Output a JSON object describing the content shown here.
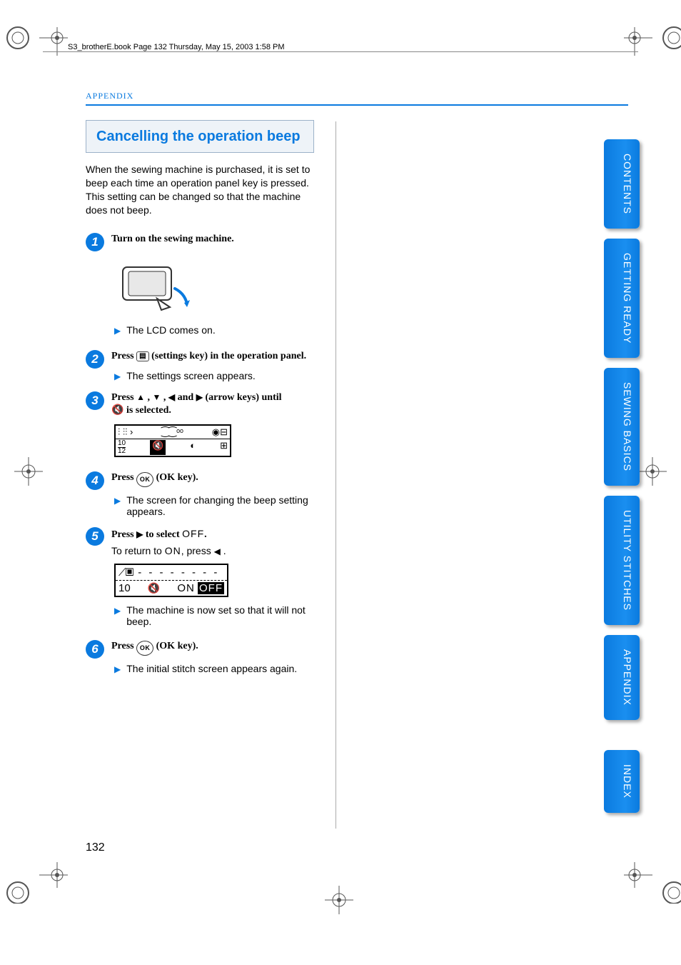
{
  "header_line": "S3_brotherE.book  Page 132  Thursday, May 15, 2003  1:58 PM",
  "section_label": "APPENDIX",
  "title": "Cancelling the operation beep",
  "intro": "When the sewing machine is purchased, it is set to beep each time an operation panel key is pressed. This setting can be changed so that the machine does not beep.",
  "steps": {
    "s1": {
      "num": "1",
      "head": "Turn on the sewing machine.",
      "result": "The LCD comes on."
    },
    "s2": {
      "num": "2",
      "head_pre": "Press ",
      "head_post": " (settings key) in the operation panel.",
      "result": "The settings screen appears."
    },
    "s3": {
      "num": "3",
      "head_pre": "Press ",
      "head_mid": " ,  ",
      "head_mid2": " ,  ",
      "head_and": " and ",
      "head_post": " (arrow keys) until ",
      "head_tail": " is selected."
    },
    "s4": {
      "num": "4",
      "head_pre": "Press ",
      "head_post": " (OK key).",
      "result": "The screen for changing the beep setting appears."
    },
    "s5": {
      "num": "5",
      "head_pre": "Press ",
      "head_mid": " to select ",
      "off_glyph": "OFF",
      "head_post": ".",
      "sub_pre": "To return to ",
      "on_glyph": "ON",
      "sub_mid": ", press ",
      "sub_post": " .",
      "result": "The machine is now set so that it will not beep."
    },
    "s6": {
      "num": "6",
      "head_pre": "Press ",
      "head_post": " (OK key).",
      "result": "The initial stitch screen appears again."
    }
  },
  "lcd2": {
    "left": "10",
    "on": "ON",
    "off": "OFF"
  },
  "lcd1": {
    "frac_top": "10",
    "frac_bot": "12"
  },
  "ok_label": "OK",
  "page_number": "132",
  "tabs": [
    "CONTENTS",
    "GETTING READY",
    "SEWING BASICS",
    "UTILITY STITCHES",
    "APPENDIX",
    "INDEX"
  ]
}
